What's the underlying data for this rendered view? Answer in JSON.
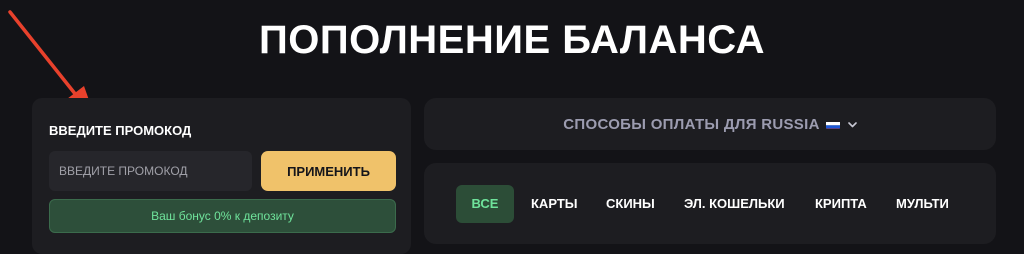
{
  "page": {
    "title": "ПОПОЛНЕНИЕ БАЛАНСА"
  },
  "promo": {
    "label": "ВВЕДИТЕ ПРОМОКОД",
    "input_value": "",
    "input_placeholder": "ВВЕДИТЕ ПРОМОКОД",
    "apply_label": "ПРИМЕНИТЬ",
    "bonus_text": "Ваш бонус 0% к депозиту"
  },
  "methods": {
    "label": "СПОСОБЫ ОПЛАТЫ ДЛЯ RUSSIA",
    "flag_icon": "russia-flag-icon",
    "dropdown_icon": "chevron-down-icon"
  },
  "tabs": [
    {
      "label": "ВСЕ",
      "active": true
    },
    {
      "label": "КАРТЫ",
      "active": false
    },
    {
      "label": "СКИНЫ",
      "active": false
    },
    {
      "label": "ЭЛ. КОШЕЛЬКИ",
      "active": false
    },
    {
      "label": "КРИПТА",
      "active": false
    },
    {
      "label": "МУЛЬТИ",
      "active": false
    }
  ],
  "colors": {
    "background": "#131317",
    "panel": "#1d1d21",
    "accent_yellow": "#f0c26a",
    "accent_green": "#6fe39b",
    "arrow_red": "#e8412c"
  }
}
